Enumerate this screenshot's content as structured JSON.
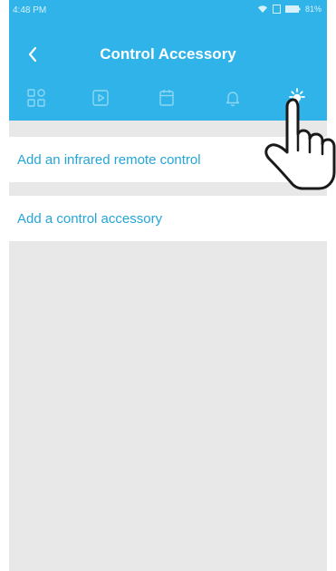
{
  "status_bar": {
    "time": "4:48 PM",
    "battery": "81%"
  },
  "header": {
    "title": "Control Accessory"
  },
  "tabs": [
    {
      "icon": "grid-icon",
      "selected": false
    },
    {
      "icon": "play-icon",
      "selected": false
    },
    {
      "icon": "calendar-icon",
      "selected": false
    },
    {
      "icon": "bell-icon",
      "selected": false
    },
    {
      "icon": "lightbulb-icon",
      "selected": true
    }
  ],
  "list": {
    "items": [
      {
        "label": "Add an infrared remote control"
      },
      {
        "label": "Add a control accessory"
      }
    ]
  },
  "colors": {
    "accent": "#2fb3e8",
    "link": "#24a5da",
    "background": "#e8e8e8"
  }
}
